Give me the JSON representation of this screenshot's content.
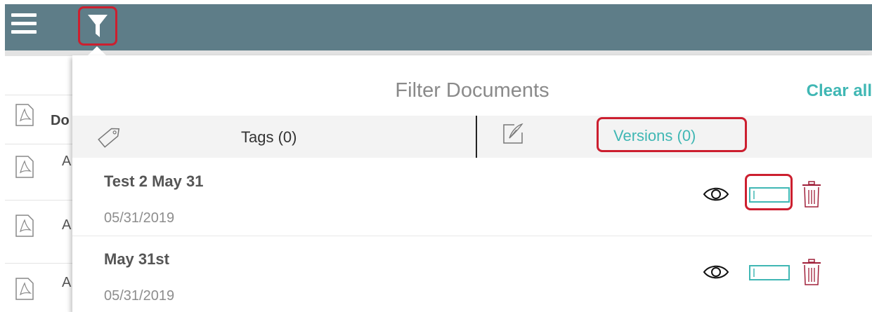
{
  "toolbar": {
    "menu_icon": "hamburger-menu-icon",
    "filter_icon": "funnel-filter-icon",
    "background_color": "#5e7d88",
    "highlight_color": "#cc1f2f"
  },
  "background_list": {
    "header_label": "Do",
    "items": [
      {
        "label": "A",
        "icon": "pdf-file-icon"
      },
      {
        "label": "A",
        "icon": "pdf-file-icon"
      },
      {
        "label": "A",
        "icon": "pdf-file-icon"
      }
    ]
  },
  "filter_panel": {
    "title": "Filter Documents",
    "clear_all_label": "Clear all",
    "accent_color": "#40b7b4",
    "tabs": [
      {
        "label": "Tags (0)",
        "icon": "tag-icon",
        "active": false
      },
      {
        "label": "Versions (0)",
        "icon": "edit-document-icon",
        "active": true
      }
    ],
    "versions": [
      {
        "name": "Test 2 May 31",
        "date": "05/31/2019",
        "actions": [
          "view-eye-icon",
          "rename-field-icon",
          "trash-icon"
        ]
      },
      {
        "name": "May 31st",
        "date": "05/31/2019",
        "actions": [
          "view-eye-icon",
          "rename-field-icon",
          "trash-icon"
        ]
      }
    ]
  }
}
